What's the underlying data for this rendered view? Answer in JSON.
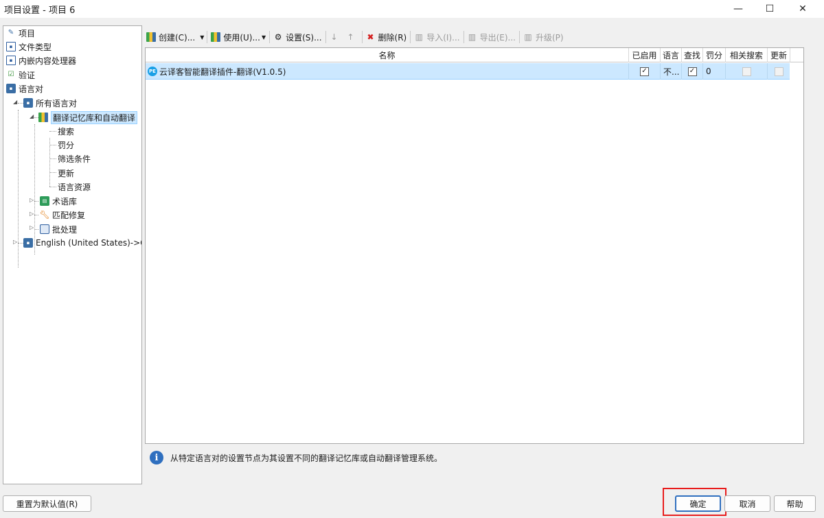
{
  "window": {
    "title": "项目设置 - 项目 6",
    "minimize_glyph": "—",
    "maximize_glyph": "☐",
    "close_glyph": "✕"
  },
  "tree": {
    "items": [
      {
        "label": "项目",
        "icon": "project-icon"
      },
      {
        "label": "文件类型",
        "icon": "file-type-icon"
      },
      {
        "label": "内嵌内容处理器",
        "icon": "embedded-content-icon"
      },
      {
        "label": "验证",
        "icon": "verification-icon"
      },
      {
        "label": "语言对",
        "icon": "language-pairs-icon"
      },
      {
        "label": "所有语言对",
        "icon": "language-pairs-icon"
      },
      {
        "label": "翻译记忆库和自动翻译",
        "icon": "translation-memory-icon",
        "selected": true
      },
      {
        "label": "搜索"
      },
      {
        "label": "罚分"
      },
      {
        "label": "筛选条件"
      },
      {
        "label": "更新"
      },
      {
        "label": "语言资源"
      },
      {
        "label": "术语库",
        "icon": "termbase-icon"
      },
      {
        "label": "匹配修复",
        "icon": "wrench-icon"
      },
      {
        "label": "批处理",
        "icon": "batch-icon"
      },
      {
        "label": "English (United States)->Ger",
        "icon": "language-pairs-icon"
      }
    ]
  },
  "toolbar": {
    "create": "创建(C)...",
    "use": "使用(U)...",
    "settings": "设置(S)...",
    "delete": "删除(R)",
    "import": "导入(I)...",
    "export": "导出(E)...",
    "upgrade": "升级(P)"
  },
  "grid": {
    "columns": [
      "名称",
      "已启用",
      "语言",
      "查找",
      "罚分",
      "相关搜索",
      "更新"
    ],
    "rows": [
      {
        "badge": "PE",
        "name": "云译客智能翻译插件-翻译(V1.0.5)",
        "enabled": true,
        "language": "不...",
        "lookup": true,
        "penalty": "0",
        "concordance": false,
        "update": false
      }
    ]
  },
  "info": {
    "icon": "i",
    "text": "从特定语言对的设置节点为其设置不同的翻译记忆库或自动翻译管理系统。"
  },
  "buttons": {
    "reset": "重置为默认值(R)",
    "ok": "确定",
    "cancel": "取消",
    "help": "帮助"
  }
}
